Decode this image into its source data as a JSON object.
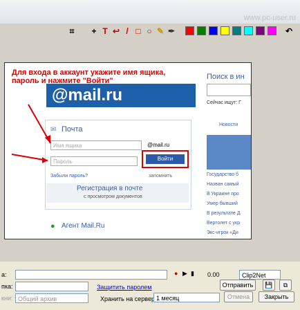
{
  "window": {
    "watermark": "www.pc-user.ru"
  },
  "toolbar": {
    "tools": [
      "crop",
      "cross",
      "text",
      "arrow",
      "pencil",
      "rect",
      "ellipse",
      "marker",
      "dropper"
    ],
    "tool_glyphs": [
      "⌗",
      "+",
      "T",
      "↩",
      "/",
      "□",
      "○",
      "✎",
      "✒"
    ],
    "colors": [
      "#ff0000",
      "#008000",
      "#0000ff",
      "#ffff00",
      "#008080",
      "#00ffff",
      "#800080",
      "#ff00ff"
    ],
    "undo_glyph": "↶"
  },
  "screenshot": {
    "instruction": "Для входа в аккаунт укажите имя ящика, пароль и нажмите \"Войти\"",
    "logo": "@mail.ru",
    "mail_title": "Почта",
    "login_placeholder": "Имя ящика",
    "domain_select": "@mail.ru",
    "password_placeholder": "Пароль",
    "login_button": "Войти",
    "forgot_link": "Забыли пароль?",
    "remember_label": "запомнить",
    "register_title": "Регистрация в почте",
    "register_sub": "с просмотром документов",
    "agent_title": "Агент Mail.Ru",
    "search_title": "Поиск в ин",
    "search_hint": "Сейчас ищут: Г",
    "news_tab": "Новости",
    "news": [
      "Государство б",
      "Назван самый",
      "В Украине про",
      "Умер бывший",
      "В результате Д",
      "Вертолет с укр",
      "Экс-игрок «Ди"
    ]
  },
  "bottom": {
    "row1_label": "а:",
    "row1_right_label": "Clip2Net",
    "row1_num": "0.00",
    "row2_label": "пка:",
    "change_password_link": "Защитить паролем",
    "send_button": "Отправить",
    "row3_label": "кни:",
    "archive_select": "Общий архив",
    "store_label": "Хранить на сервере:",
    "store_select": "1 месяц",
    "cancel_button": "Отмена",
    "close_button": "Закрыть"
  }
}
